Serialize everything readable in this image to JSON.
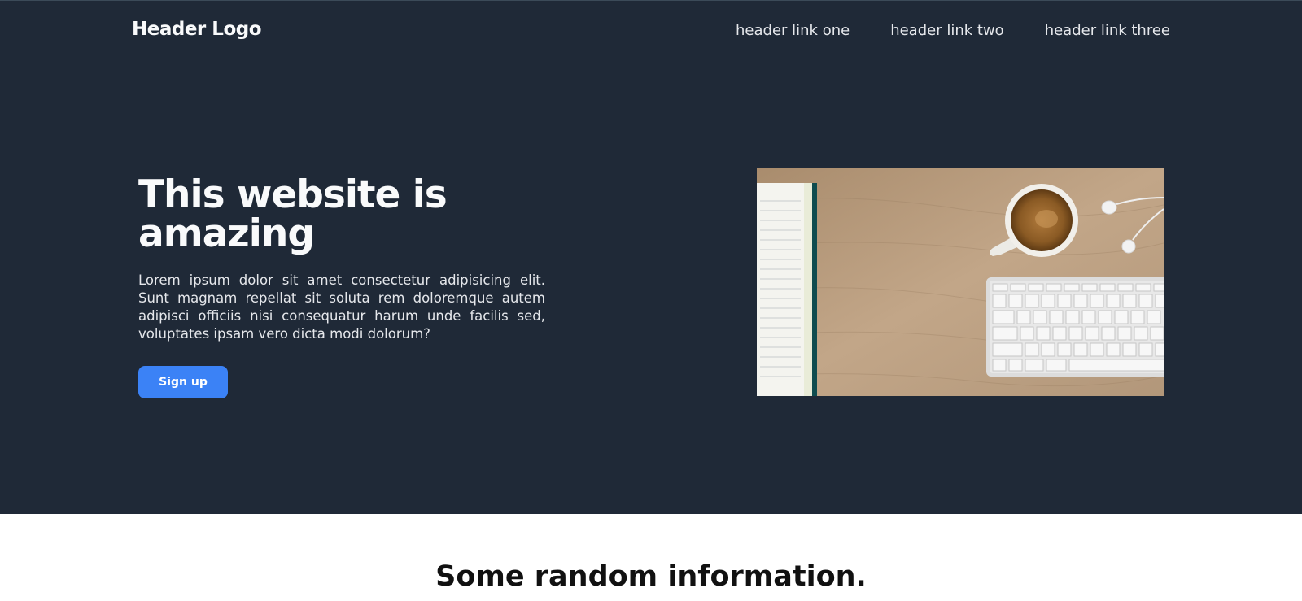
{
  "header": {
    "logo": "Header Logo",
    "links": [
      "header link one",
      "header link two",
      "header link three"
    ]
  },
  "hero": {
    "title": "This website is amazing",
    "body": "Lorem ipsum dolor sit amet consectetur adipisicing elit. Sunt magnam repellat sit soluta rem doloremque autem adipisci officiis nisi consequatur harum unde facilis sed, voluptates ipsam vero dicta modi dolorum?",
    "button": "Sign up"
  },
  "info": {
    "title": "Some random information."
  },
  "colors": {
    "hero_background": "#1f2937",
    "button": "#3b82f6",
    "page_background": "#ffffff"
  }
}
